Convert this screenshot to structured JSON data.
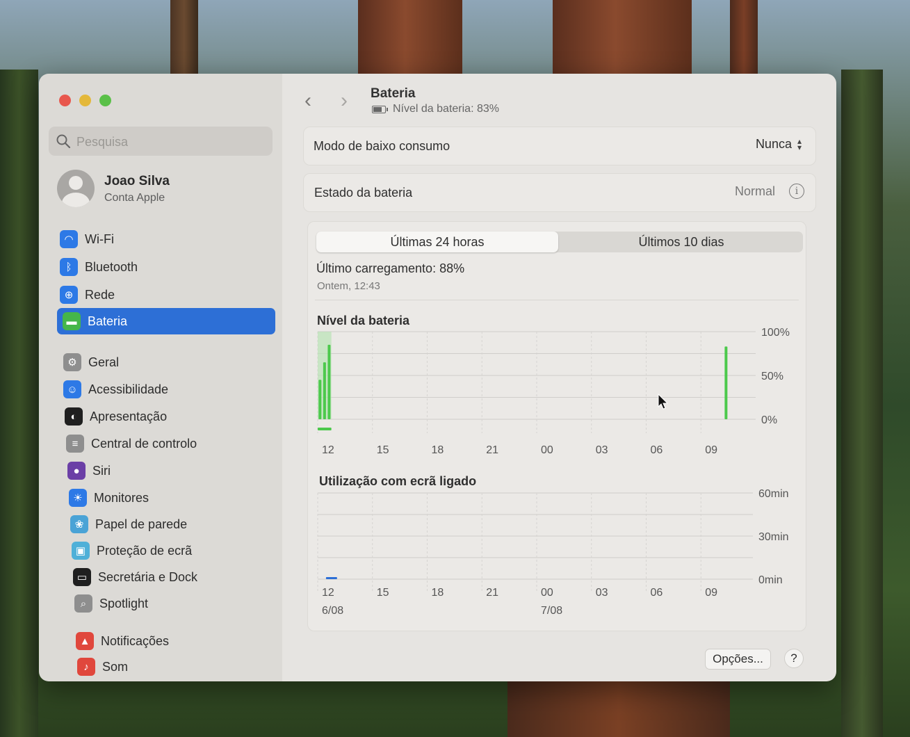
{
  "sidebar": {
    "search_placeholder": "Pesquisa",
    "account": {
      "name": "Joao Silva",
      "subtitle": "Conta Apple"
    },
    "items": [
      {
        "label": "Wi-Fi",
        "icon": "wifi-icon",
        "color": "#2d79e6"
      },
      {
        "label": "Bluetooth",
        "icon": "bluetooth-icon",
        "color": "#2d79e6"
      },
      {
        "label": "Rede",
        "icon": "globe-icon",
        "color": "#2d79e6"
      },
      {
        "label": "Bateria",
        "icon": "battery-icon",
        "color": "#45b64a",
        "active": true
      },
      {
        "label": "Geral",
        "icon": "gear-icon",
        "color": "#8e8e8e"
      },
      {
        "label": "Acessibilidade",
        "icon": "accessibility-icon",
        "color": "#2d79e6"
      },
      {
        "label": "Apresentação",
        "icon": "appearance-icon",
        "color": "#1f1f1f"
      },
      {
        "label": "Central de controlo",
        "icon": "control-center-icon",
        "color": "#8e8e8e"
      },
      {
        "label": "Siri",
        "icon": "siri-icon",
        "color": "#6b3fa6"
      },
      {
        "label": "Monitores",
        "icon": "display-icon",
        "color": "#2d79e6"
      },
      {
        "label": "Papel de parede",
        "icon": "wallpaper-icon",
        "color": "#4aa3d6"
      },
      {
        "label": "Proteção de ecrã",
        "icon": "screensaver-icon",
        "color": "#4fb0d8"
      },
      {
        "label": "Secretária e Dock",
        "icon": "dock-icon",
        "color": "#1f1f1f"
      },
      {
        "label": "Spotlight",
        "icon": "spotlight-icon",
        "color": "#8e8e8e"
      },
      {
        "label": "Notificações",
        "icon": "notifications-icon",
        "color": "#e0473c"
      },
      {
        "label": "Som",
        "icon": "sound-icon",
        "color": "#e0473c"
      }
    ]
  },
  "header": {
    "title": "Bateria",
    "subtitle": "Nível da bateria: 83%"
  },
  "low_power": {
    "label": "Modo de baixo consumo",
    "value": "Nunca"
  },
  "battery_health": {
    "label": "Estado da bateria",
    "value": "Normal"
  },
  "tabs": [
    "Últimas 24 horas",
    "Últimos 10 dias"
  ],
  "last_charge": {
    "label": "Último carregamento: 88%",
    "time": "Ontem, 12:43"
  },
  "buttons": {
    "options": "Opções...",
    "help": "?"
  },
  "chart_data": [
    {
      "type": "bar",
      "title": "Nível da bateria",
      "x_ticks": [
        "12",
        "15",
        "18",
        "21",
        "00",
        "03",
        "06",
        "09"
      ],
      "y_ticks": [
        "100%",
        "50%",
        "0%"
      ],
      "ylim": [
        0,
        100
      ],
      "bars": [
        {
          "x_hour_offset": 0.05,
          "value": 45
        },
        {
          "x_hour_offset": 0.3,
          "value": 65
        },
        {
          "x_hour_offset": 0.55,
          "value": 85
        },
        {
          "x_hour_offset": 22.3,
          "value": 83
        }
      ],
      "charging_highlight": [
        0,
        0.75
      ],
      "color": "#4cc94c"
    },
    {
      "type": "bar",
      "title": "Utilização com ecrã ligado",
      "x_ticks": [
        "12",
        "15",
        "18",
        "21",
        "00",
        "03",
        "06",
        "09"
      ],
      "date_labels": [
        {
          "tick": "12",
          "text": "6/08"
        },
        {
          "tick": "00",
          "text": "7/08"
        }
      ],
      "y_ticks": [
        "60min",
        "30min",
        "0min"
      ],
      "ylim": [
        0,
        60
      ],
      "bars": [
        {
          "x_hour_offset": 0.3,
          "value": 1
        }
      ],
      "color": "#2d6fd6"
    }
  ]
}
